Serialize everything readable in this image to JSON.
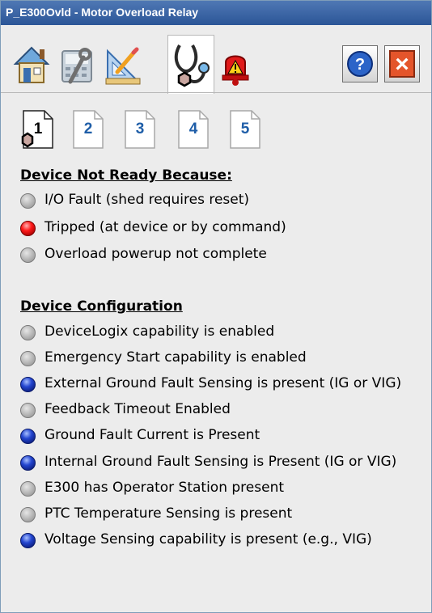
{
  "window": {
    "title": "P_E300Ovld - Motor Overload Relay"
  },
  "toolbar": {
    "tabs": [
      {
        "icon": "home-icon"
      },
      {
        "icon": "maintenance-icon"
      },
      {
        "icon": "engineering-icon"
      },
      {
        "icon": "diagnostics-icon"
      },
      {
        "icon": "alarm-icon"
      }
    ],
    "active_tab": 3,
    "help_icon": "help-icon",
    "close_icon": "close-icon",
    "help_symbol": "?",
    "close_symbol": "×"
  },
  "pages": {
    "labels": [
      "1",
      "2",
      "3",
      "4",
      "5"
    ],
    "active": 0
  },
  "not_ready": {
    "title": "Device Not Ready Because:",
    "items": [
      {
        "label": "I/O Fault (shed requires reset)",
        "state": "off"
      },
      {
        "label": "Tripped (at device or by command)",
        "state": "red"
      },
      {
        "label": "Overload powerup not complete",
        "state": "off"
      }
    ]
  },
  "config": {
    "title": "Device Configuration",
    "items": [
      {
        "label": "DeviceLogix capability is enabled",
        "state": "off"
      },
      {
        "label": "Emergency Start capability is enabled",
        "state": "off"
      },
      {
        "label": "External Ground Fault Sensing is present (IG or VIG)",
        "state": "blue"
      },
      {
        "label": "Feedback Timeout Enabled",
        "state": "off"
      },
      {
        "label": "Ground Fault Current is Present",
        "state": "blue"
      },
      {
        "label": "Internal Ground Fault Sensing is Present (IG or VIG)",
        "state": "blue"
      },
      {
        "label": "E300 has Operator Station present",
        "state": "off"
      },
      {
        "label": "PTC Temperature Sensing is present",
        "state": "off"
      },
      {
        "label": "Voltage Sensing capability is present (e.g., VIG)",
        "state": "blue"
      }
    ]
  },
  "colors": {
    "title_bar": "#2b5597",
    "led_red": "#ff1a1a",
    "led_blue": "#2446d0",
    "led_off": "#c0c0c0",
    "page_number": "#1f5ea8"
  }
}
